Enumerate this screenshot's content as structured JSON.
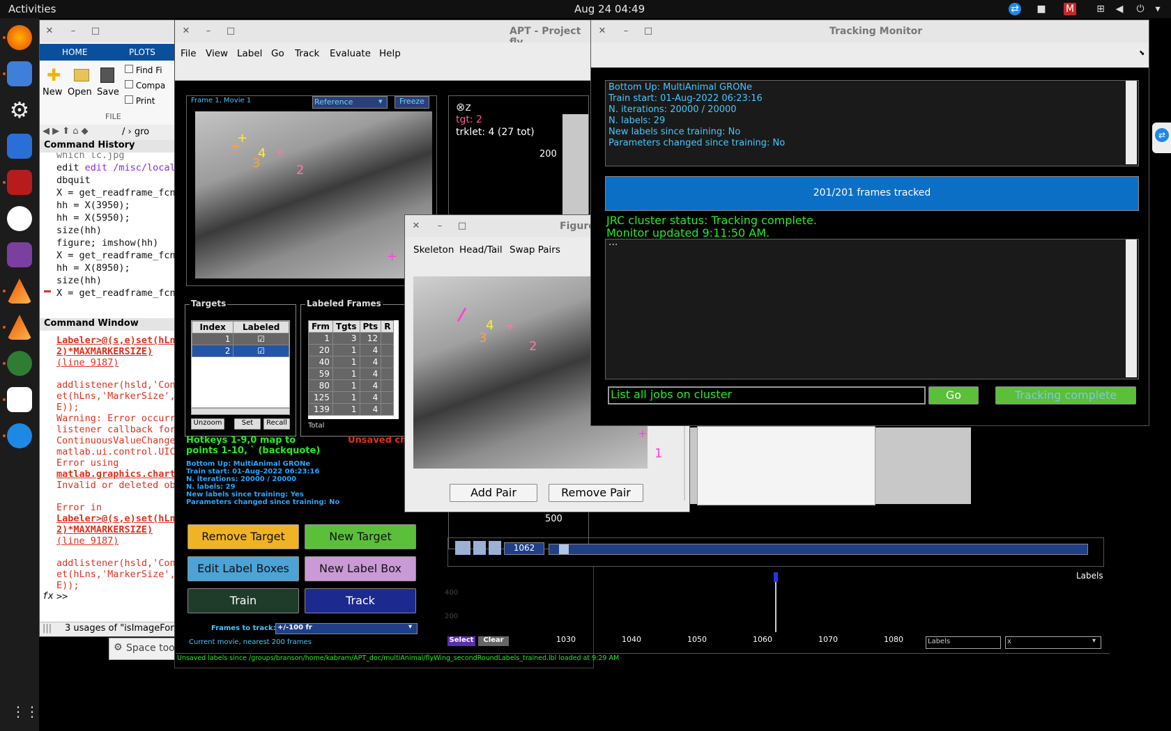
{
  "topbar": {
    "activities": "Activities",
    "clock": "Aug 24  04:49"
  },
  "matlab": {
    "tabs": [
      "HOME",
      "PLOTS"
    ],
    "file": {
      "new": "New",
      "open": "Open",
      "save": "Save",
      "find": "Find Fi",
      "compare": "Compa",
      "print": "Print",
      "group": "FILE"
    },
    "path": "/ › gro",
    "history_title": "Command History",
    "history": [
      "which lc.jpg",
      "edit /misc/local/matl",
      "dbquit",
      "X = get_readframe_fcn",
      "hh = X(3950);",
      "hh = X(5950);",
      "size(hh)",
      "figure; imshow(hh)",
      "X = get_readframe_fcn",
      "hh = X(8950);",
      "size(hh)",
      "X = get_readframe_fcn"
    ],
    "cmdwin_title": "Command Window",
    "cmdwin": {
      "l1": "Labeler>@(s,e)set(hLns",
      "l2": "2)*MAXMARKERSIZE)",
      "l3": "(line 9187)",
      "l4": "addlistener(hsld,'Con",
      "l5": "et(hLns,'MarkerSize',",
      "l6": "E));",
      "l7": "Warning: Error occurr",
      "l8": "listener callback for",
      "l9": "ContinuousValueChange",
      "l10": "matlab.ui.control.UIC",
      "l11": "Error using",
      "l12": "matlab.graphics.chart",
      "l13": "Invalid or deleted ob",
      "l14": "Error in",
      "l15": "Labeler>@(s,e)set(hLns",
      "l16": "2)*MAXMARKERSIZE)",
      "l17": "(line 9187)",
      "l18": "addlistener(hsld,'Con",
      "l19": "et(hLns,'MarkerSize',",
      "l20": "E));",
      "prompt": ">>"
    },
    "status": "3 usages of \"isImageForm",
    "spacetool": "Space too"
  },
  "apt": {
    "title": "APT - Project fly",
    "menu": [
      "File",
      "View",
      "Label",
      "Go",
      "Track",
      "Evaluate",
      "Help"
    ],
    "frame_label": "Frame 1, Movie 1",
    "ref_select": "Reference",
    "freeze": "Freeze",
    "tgt": "tgt: 2",
    "trklet": "trklet: 4 (27 tot)",
    "y200": "200",
    "y500": "500",
    "targets_title": "Targets",
    "targets_cols": [
      "Index",
      "Labeled"
    ],
    "targets_rows": [
      {
        "i": "1"
      },
      {
        "i": "2"
      }
    ],
    "unzoom": "Unzoom",
    "set": "Set",
    "recall": "Recall",
    "lf_title": "Labeled Frames",
    "lf_cols": [
      "Frm",
      "Tgts",
      "Pts",
      "R"
    ],
    "lf_rows": [
      [
        "1",
        "3",
        "12"
      ],
      [
        "20",
        "1",
        "4"
      ],
      [
        "40",
        "1",
        "4"
      ],
      [
        "59",
        "1",
        "4"
      ],
      [
        "80",
        "1",
        "4"
      ],
      [
        "125",
        "1",
        "4"
      ],
      [
        "139",
        "1",
        "4"
      ]
    ],
    "lf_total": "Total",
    "hotkeys": "Hotkeys 1-9,0 map to points 1-10, ` (backquote)",
    "unsaved": "Unsaved ch",
    "info": [
      "Bottom Up: MultiAnimal GRONe",
      "Train start: 01-Aug-2022 06:23:16",
      "N. iterations: 20000 / 20000",
      "N. labels: 29",
      "New labels since training: Yes",
      "Parameters changed since training: No"
    ],
    "buttons": {
      "remove_target": "Remove Target",
      "new_target": "New Target",
      "edit_label_boxes": "Edit Label Boxes",
      "new_label_box": "New Label Box",
      "train": "Train",
      "track": "Track"
    },
    "frames_to_track_label": "Frames to track:",
    "frames_to_track": "+/-100 fr",
    "current_movie": "Current movie, nearest 200 frames",
    "frame_num": "1062",
    "labels": "Labels",
    "timeline_ticks": [
      "1030",
      "1040",
      "1050",
      "1060",
      "1070",
      "1080"
    ],
    "tl_y": [
      "400",
      "200"
    ],
    "select": "Select",
    "clear": "Clear",
    "labels_dd": "Labels",
    "x_dd": "x",
    "statusbar": "Unsaved labels since /groups/branson/home/kabram/APT_doc/multiAnimal/flyWing_secondRoundLabels_trained.lbl loaded at  9:29 AM",
    "kp": [
      "4",
      "3",
      "2",
      "1"
    ]
  },
  "figure": {
    "title": "Figure",
    "tabs": [
      "Skeleton",
      "Head/Tail",
      "Swap Pairs"
    ],
    "add_pair": "Add Pair",
    "remove_pair": "Remove Pair",
    "kp": [
      "4",
      "3",
      "2",
      "1"
    ]
  },
  "monitor": {
    "title": "Tracking Monitor",
    "info": [
      "Bottom Up: MultiAnimal GRONe",
      "Train start: 01-Aug-2022 06:23:16",
      "N. iterations: 20000 / 20000",
      "N. labels: 29",
      "New labels since training: No",
      "Parameters changed since training: No"
    ],
    "progress": "201/201 frames tracked",
    "progress_value": 1.0,
    "cluster": "JRC cluster status: Tracking complete.",
    "updated": "Monitor updated  9:11:50 AM.",
    "log": "...",
    "action": "List all jobs on cluster",
    "go": "Go",
    "complete": "Tracking complete"
  },
  "colors": {
    "accent": "#0a6fc2",
    "progress": "#0b6fc6",
    "green": "#22ee22",
    "remove": "#f0b323",
    "newtarget": "#5bbf3a",
    "editbox": "#4ba3d6",
    "newbox": "#c99ad6",
    "train": "#1f3b2a",
    "track": "#1c2a8f"
  }
}
